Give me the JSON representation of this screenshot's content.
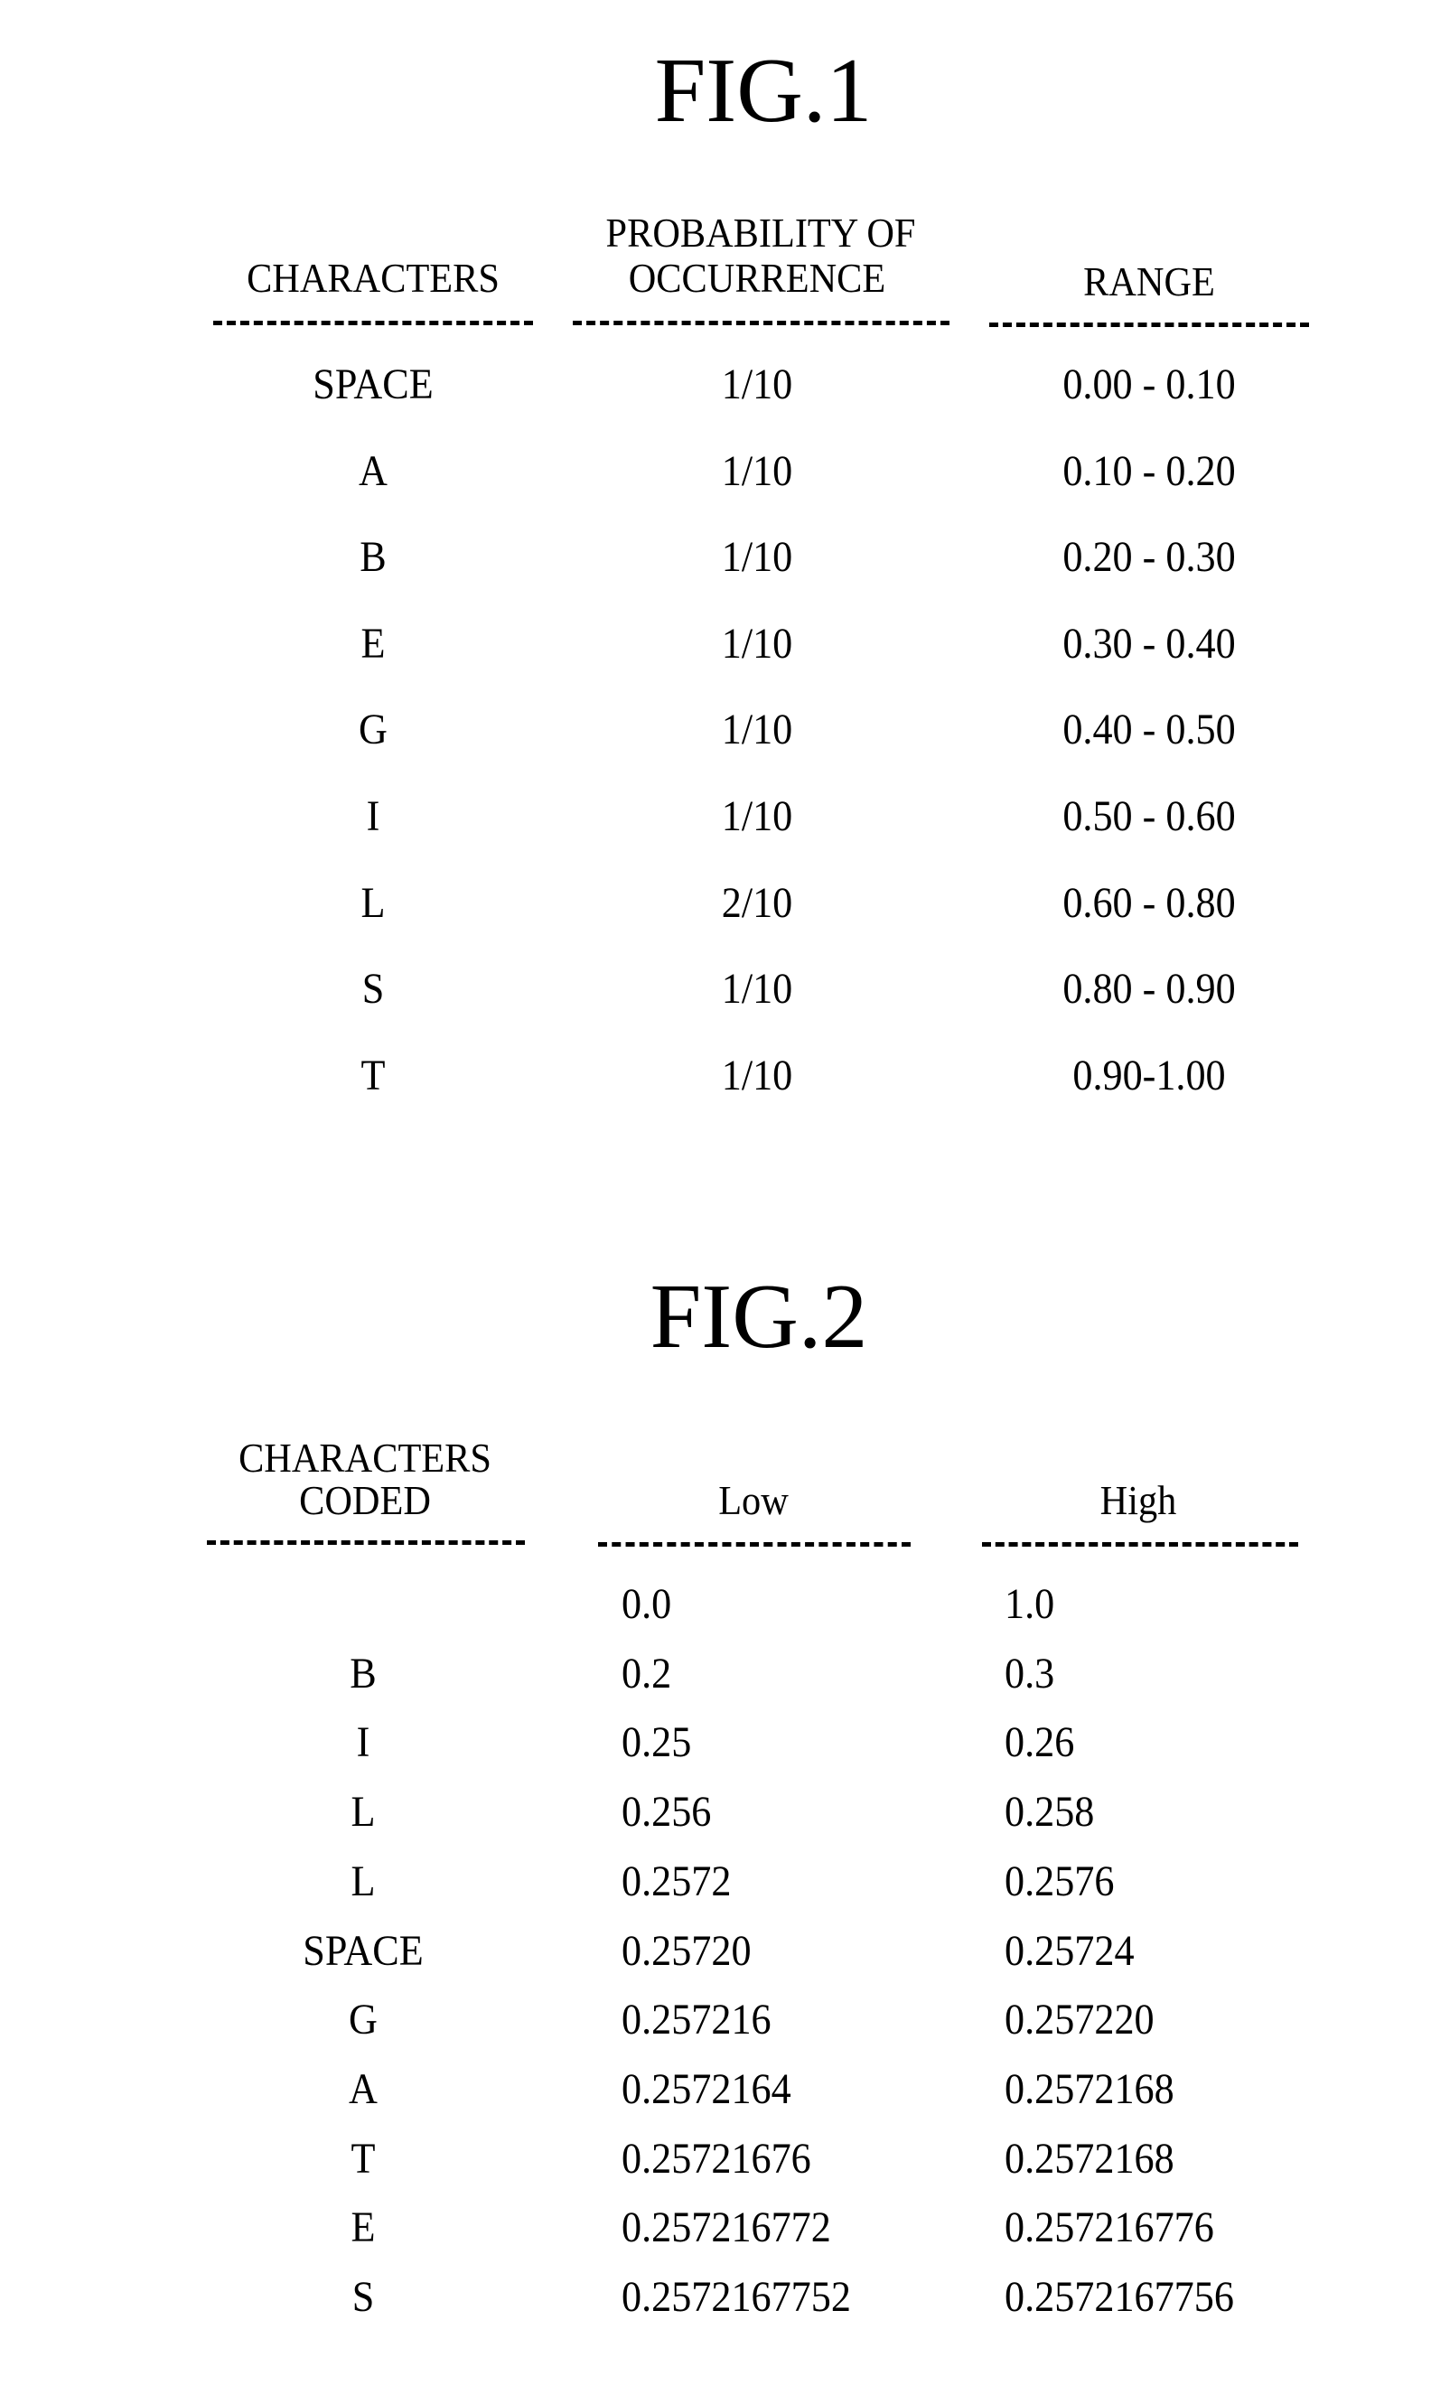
{
  "fig1": {
    "title": "FIG.1",
    "headers": {
      "characters": "CHARACTERS",
      "probability_line1": "PROBABILITY OF",
      "probability_line2": "OCCURRENCE",
      "range": "RANGE"
    },
    "rows": [
      {
        "char": "SPACE",
        "prob": "1/10",
        "range": "0.00 - 0.10"
      },
      {
        "char": "A",
        "prob": "1/10",
        "range": "0.10 - 0.20"
      },
      {
        "char": "B",
        "prob": "1/10",
        "range": "0.20 - 0.30"
      },
      {
        "char": "E",
        "prob": "1/10",
        "range": "0.30 - 0.40"
      },
      {
        "char": "G",
        "prob": "1/10",
        "range": "0.40 - 0.50"
      },
      {
        "char": "I",
        "prob": "1/10",
        "range": "0.50 - 0.60"
      },
      {
        "char": "L",
        "prob": "2/10",
        "range": "0.60 - 0.80"
      },
      {
        "char": "S",
        "prob": "1/10",
        "range": "0.80 - 0.90"
      },
      {
        "char": "T",
        "prob": "1/10",
        "range": "0.90-1.00"
      }
    ]
  },
  "fig2": {
    "title": "FIG.2",
    "headers": {
      "characters_line1": "CHARACTERS",
      "characters_line2": "CODED",
      "low": "Low",
      "high": "High"
    },
    "rows": [
      {
        "char": "",
        "low": "0.0",
        "high": "1.0"
      },
      {
        "char": "B",
        "low": "0.2",
        "high": "0.3"
      },
      {
        "char": "I",
        "low": "0.25",
        "high": "0.26"
      },
      {
        "char": "L",
        "low": "0.256",
        "high": "0.258"
      },
      {
        "char": "L",
        "low": "0.2572",
        "high": "0.2576"
      },
      {
        "char": "SPACE",
        "low": "0.25720",
        "high": "0.25724"
      },
      {
        "char": "G",
        "low": "0.257216",
        "high": "0.257220"
      },
      {
        "char": "A",
        "low": "0.2572164",
        "high": "0.2572168"
      },
      {
        "char": "T",
        "low": "0.25721676",
        "high": "0.2572168"
      },
      {
        "char": "E",
        "low": "0.257216772",
        "high": "0.257216776"
      },
      {
        "char": "S",
        "low": "0.2572167752",
        "high": "0.2572167756"
      }
    ]
  }
}
